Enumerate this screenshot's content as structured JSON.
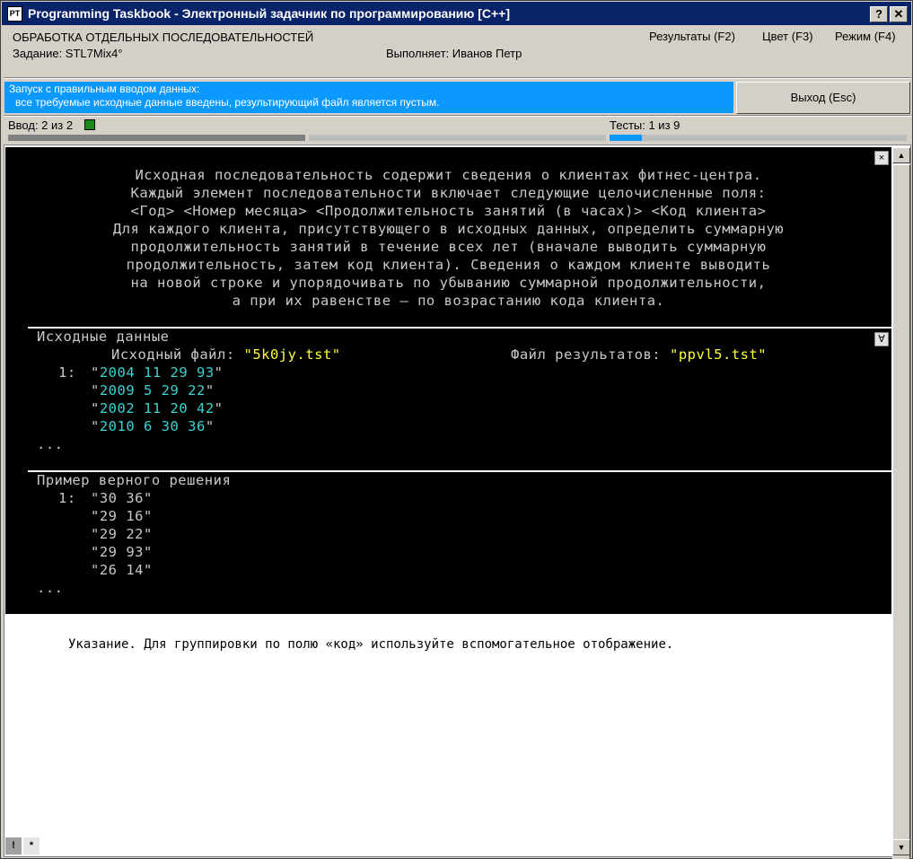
{
  "window": {
    "title": "Programming Taskbook - Электронный задачник по программированию [C++]",
    "icon_label": "PT",
    "help_btn": "?",
    "close_btn": "✕"
  },
  "header": {
    "group": "ОБРАБОТКА ОТДЕЛЬНЫХ ПОСЛЕДОВАТЕЛЬНОСТЕЙ",
    "task": "Задание: STL7Mix4°",
    "executor": "Выполняет: Иванов Петр",
    "menu": {
      "results": "Результаты (F2)",
      "color": "Цвет (F3)",
      "mode": "Режим (F4)"
    }
  },
  "status": {
    "line1": "Запуск с правильным вводом данных:",
    "line2": "все требуемые исходные данные введены, результирующий файл является пустым.",
    "exit_button": "Выход (Esc)",
    "color": "#0b99ff"
  },
  "progress": {
    "input_label": "Ввод: 2 из 2",
    "input_done": 2,
    "input_total": 2,
    "tests_label": "Тесты: 1 из 9",
    "tests_done": 1,
    "tests_total": 9
  },
  "task_text": [
    "Исходная последовательность содержит сведения о клиентах фитнес-центра.",
    "Каждый элемент последовательности включает следующие целочисленные поля:",
    "<Год> <Номер месяца> <Продолжительность занятий (в часах)> <Код клиента>",
    "Для каждого клиента, присутствующего в исходных данных, определить суммарную",
    "продолжительность занятий в течение всех лет (вначале выводить суммарную",
    "продолжительность, затем код клиента). Сведения о каждом клиенте выводить",
    "на новой строке и упорядочивать по убыванию суммарной продолжительности,",
    "а при их равенстве — по возрастанию кода клиента."
  ],
  "input_section": {
    "title": "Исходные данные",
    "file_label": "Исходный файл: ",
    "file_name": "\"5k0jy.tst\"",
    "result_label": "Файл результатов: ",
    "result_name": "\"ppvl5.tst\"",
    "index": "1:",
    "rows": [
      "2004 11 29 93",
      "2009 5 29 22",
      "2002 11 20 42",
      "2010 6 30 36"
    ],
    "ellipsis": "..."
  },
  "sample_section": {
    "title": "Пример верного решения",
    "index": "1:",
    "rows": [
      "\"30 36\"",
      "\"29 16\"",
      "\"29 22\"",
      "\"29 93\"",
      "\"26 14\""
    ],
    "ellipsis": "..."
  },
  "hint": "Указание. Для группировки по полю «код» используйте вспомогательное отображение.",
  "buttons": {
    "close_task": "×",
    "toggle_section": "∀",
    "bang": "!",
    "star": "*"
  }
}
